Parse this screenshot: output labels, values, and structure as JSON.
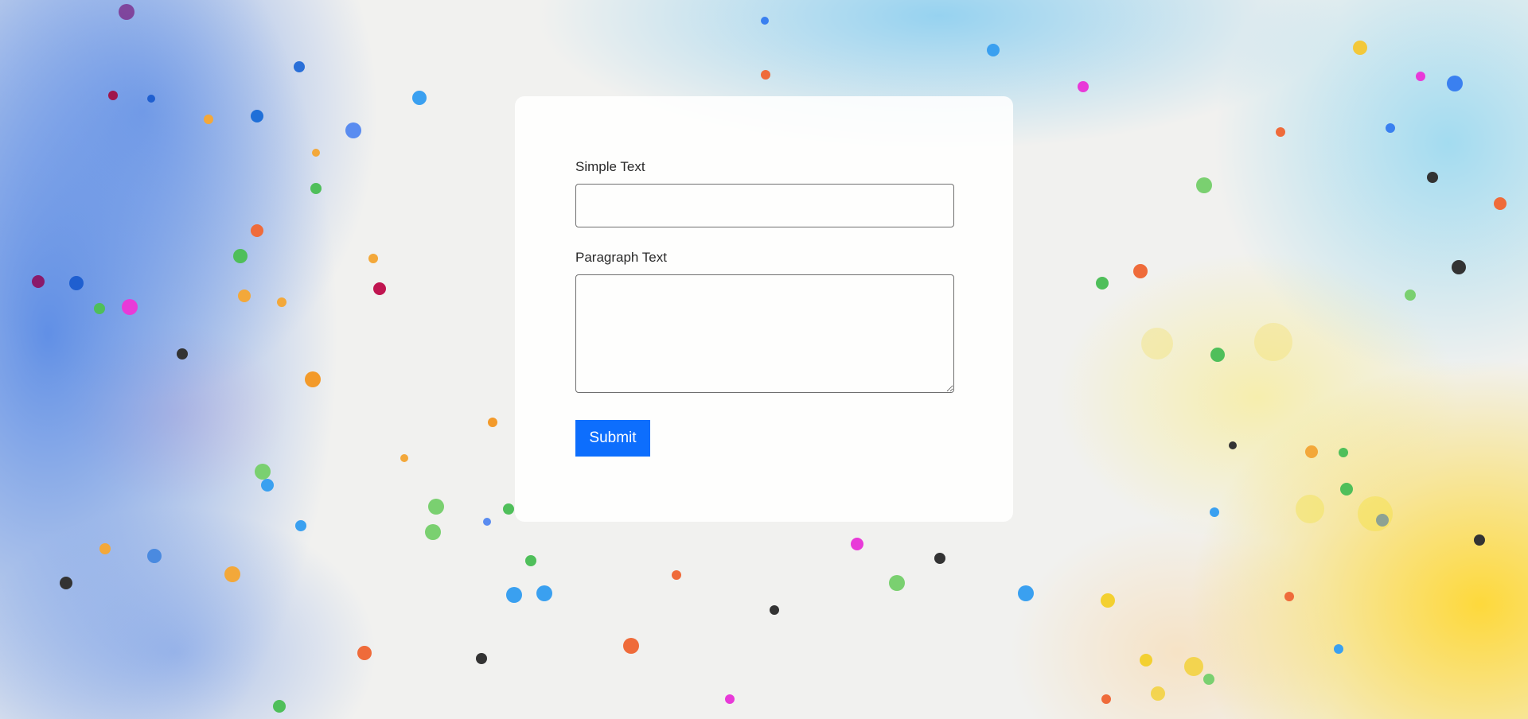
{
  "form": {
    "simple_text_label": "Simple Text",
    "simple_text_value": "",
    "paragraph_text_label": "Paragraph Text",
    "paragraph_text_value": "",
    "submit_label": "Submit"
  },
  "colors": {
    "submit_background": "#0d6efd",
    "submit_text": "#ffffff",
    "card_background": "#ffffff"
  }
}
